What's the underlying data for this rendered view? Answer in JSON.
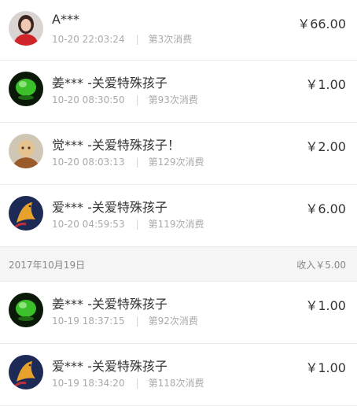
{
  "transactions_top": [
    {
      "avatar": "woman-red-avatar",
      "name": "A***",
      "time": "10-20 22:03:24",
      "count": "第3次消费",
      "amount": "￥66.00"
    },
    {
      "avatar": "green-leaf-avatar",
      "name": "姜*** -关爱特殊孩子",
      "time": "10-20 08:30:50",
      "count": "第93次消费",
      "amount": "￥1.00"
    },
    {
      "avatar": "monk-avatar",
      "name": "觉*** -关爱特殊孩子！",
      "time": "10-20 08:03:13",
      "count": "第129次消费",
      "amount": "￥2.00"
    },
    {
      "avatar": "koi-fish-avatar",
      "name": "爱*** -关爱特殊孩子",
      "time": "10-20 04:59:53",
      "count": "第119次消费",
      "amount": "￥6.00"
    }
  ],
  "section": {
    "date": "2017年10月19日",
    "income": "收入￥5.00"
  },
  "transactions_bottom": [
    {
      "avatar": "green-leaf-avatar",
      "name": "姜*** -关爱特殊孩子",
      "time": "10-19 18:37:15",
      "count": "第92次消费",
      "amount": "￥1.00"
    },
    {
      "avatar": "koi-fish-avatar",
      "name": "爱*** -关爱特殊孩子",
      "time": "10-19 18:34:20",
      "count": "第118次消费",
      "amount": "￥1.00"
    }
  ],
  "separator": "|"
}
